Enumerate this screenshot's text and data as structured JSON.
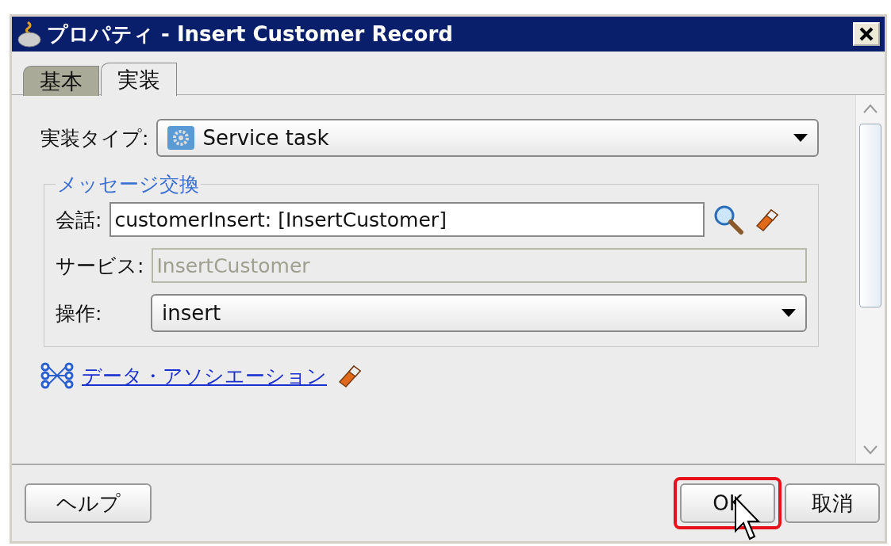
{
  "window": {
    "title": "プロパティ - Insert Customer Record"
  },
  "tabs": [
    {
      "label": "基本",
      "selected": false
    },
    {
      "label": "実装",
      "selected": true
    }
  ],
  "implementation_type": {
    "label": "実装タイプ:",
    "value": "Service task"
  },
  "message_exchange": {
    "legend": "メッセージ交換",
    "fields": [
      {
        "kind": "text",
        "label": "会話:",
        "value": "customerInsert: [InsertCustomer]",
        "disabled": false
      },
      {
        "kind": "text",
        "label": "サービス:",
        "value": "InsertCustomer",
        "disabled": true
      },
      {
        "kind": "select",
        "label": "操作:",
        "value": "insert",
        "disabled": false
      }
    ]
  },
  "data_association": {
    "link": "データ・アソシエーション"
  },
  "buttons": [
    {
      "label": "ヘルプ",
      "highlighted": false
    },
    {
      "label": "OK",
      "highlighted": true
    },
    {
      "label": "取消",
      "highlighted": false
    }
  ]
}
